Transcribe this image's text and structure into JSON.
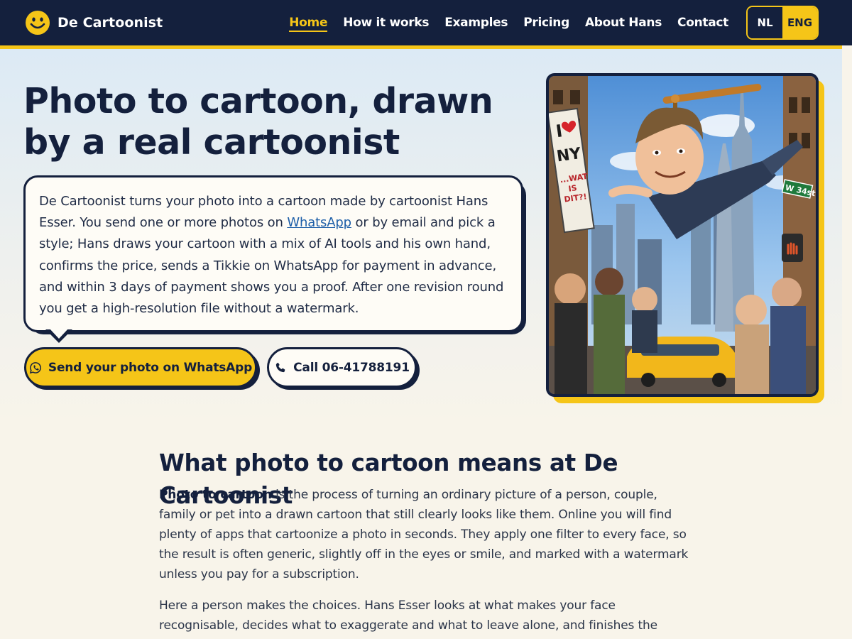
{
  "header": {
    "brand": "De Cartoonist",
    "nav": [
      {
        "label": "Home",
        "active": true
      },
      {
        "label": "How it works",
        "active": false
      },
      {
        "label": "Examples",
        "active": false
      },
      {
        "label": "Pricing",
        "active": false
      },
      {
        "label": "About Hans",
        "active": false
      },
      {
        "label": "Contact",
        "active": false
      }
    ],
    "languages": [
      {
        "label": "NL",
        "active": false
      },
      {
        "label": "ENG",
        "active": true
      }
    ]
  },
  "hero": {
    "title": "Photo to cartoon, drawn by a real cartoonist",
    "bubble_before_link": "De Cartoonist turns your photo into a cartoon made by cartoonist Hans Esser. You send one or more photos on ",
    "bubble_link": "WhatsApp",
    "bubble_after_link": " or by email and pick a style; Hans draws your cartoon with a mix of AI tools and his own hand, confirms the price, sends a Tikkie on WhatsApp for payment in advance, and within 3 days of payment shows you a proof. After one revision round you get a high-resolution file without a watermark.",
    "primary_button": "Send your photo on WhatsApp",
    "secondary_button": "Call 06-41788191",
    "image": {
      "sign_lines": [
        "I",
        "NY",
        "...WAT",
        "IS",
        "DIT?!"
      ],
      "street_sign": "W 34st"
    }
  },
  "content": {
    "section_title": "What photo to cartoon means at De Cartoonist",
    "para1_strong": "Photo to cartoon",
    "para1_rest": " is the process of turning an ordinary picture of a person, couple, family or pet into a drawn cartoon that still clearly looks like them. Online you will find plenty of apps that cartoonize a photo in seconds. They apply one filter to every face, so the result is often generic, slightly off in the eyes or smile, and marked with a watermark unless you pay for a subscription.",
    "para2": "Here a person makes the choices. Hans Esser looks at what makes your face recognisable, decides what to exaggerate and what to leave alone, and finishes the details by hand. AI"
  },
  "colors": {
    "navy": "#14203d",
    "yellow": "#f5c518",
    "cream": "#f8f4ea",
    "link": "#1e5fa8"
  },
  "icons": {
    "logo": "smiley-icon",
    "primary_button": "whatsapp-icon",
    "secondary_button": "phone-icon"
  }
}
